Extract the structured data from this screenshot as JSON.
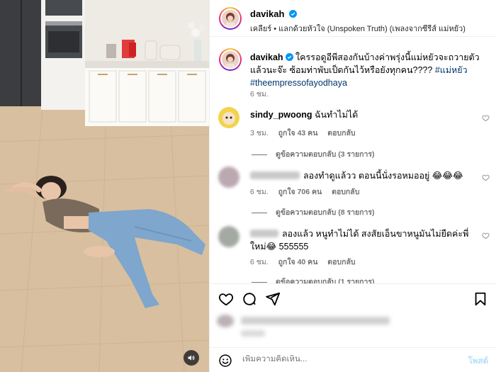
{
  "post": {
    "username": "davikah",
    "audio_line": "เคลียร์ • แลกด้วยหัวใจ (Unspoken Truth) (เพลงจากซีรีส์ แม่หยัว)",
    "caption_text": "ใครรอดูอีพีสองกันบ้างค่าพรุ่งนี้แม่หยัวจะถวายตัวแล้วนะจ๊ะ ซ้อมท่าพับเป็ดกันไว้หรือยังทุกคน???? ",
    "caption_tag1": "#แม่หยัว",
    "caption_tag2": "#theempressofayodhaya",
    "caption_time": "6 ชม."
  },
  "comments": [
    {
      "username": "sindy_pwoong",
      "text": "ฉันทำไม่ได้",
      "time": "3 ชม.",
      "likes": "ถูกใจ 43 คน",
      "reply": "ตอบกลับ",
      "view_replies": "ดูข้อความตอบกลับ (3 รายการ)"
    },
    {
      "username": "",
      "text": "ลองทำดูแล้วว ตอนนี้นั่งรอหมออยู่ 😂😂😂",
      "time": "6 ชม.",
      "likes": "ถูกใจ 706 คน",
      "reply": "ตอบกลับ",
      "view_replies": "ดูข้อความตอบกลับ (8 รายการ)"
    },
    {
      "username": "",
      "text": "ลองแล้ว หนูทำไม่ได้ สงสัยเอ็นขาหนูมันไม่ยืดค่ะพี่ใหม่😂 555555",
      "time": "6 ชม.",
      "likes": "ถูกใจ 40 คน",
      "reply": "ตอบกลับ",
      "view_replies": "ดูข้อความตอบกลับ (1 รายการ)"
    }
  ],
  "composer": {
    "placeholder": "เพิ่มความคิดเห็น...",
    "post_label": "โพสต์"
  },
  "icons": {
    "like": "heart-icon",
    "comment": "comment-icon",
    "share": "send-icon",
    "save": "bookmark-icon",
    "emoji": "emoji-icon",
    "verified": "verified-badge-icon",
    "mute": "speaker-icon"
  },
  "colors": {
    "verified": "#0095f6",
    "link": "#00376b",
    "meta": "#737373",
    "post_button": "#b2dffc"
  }
}
